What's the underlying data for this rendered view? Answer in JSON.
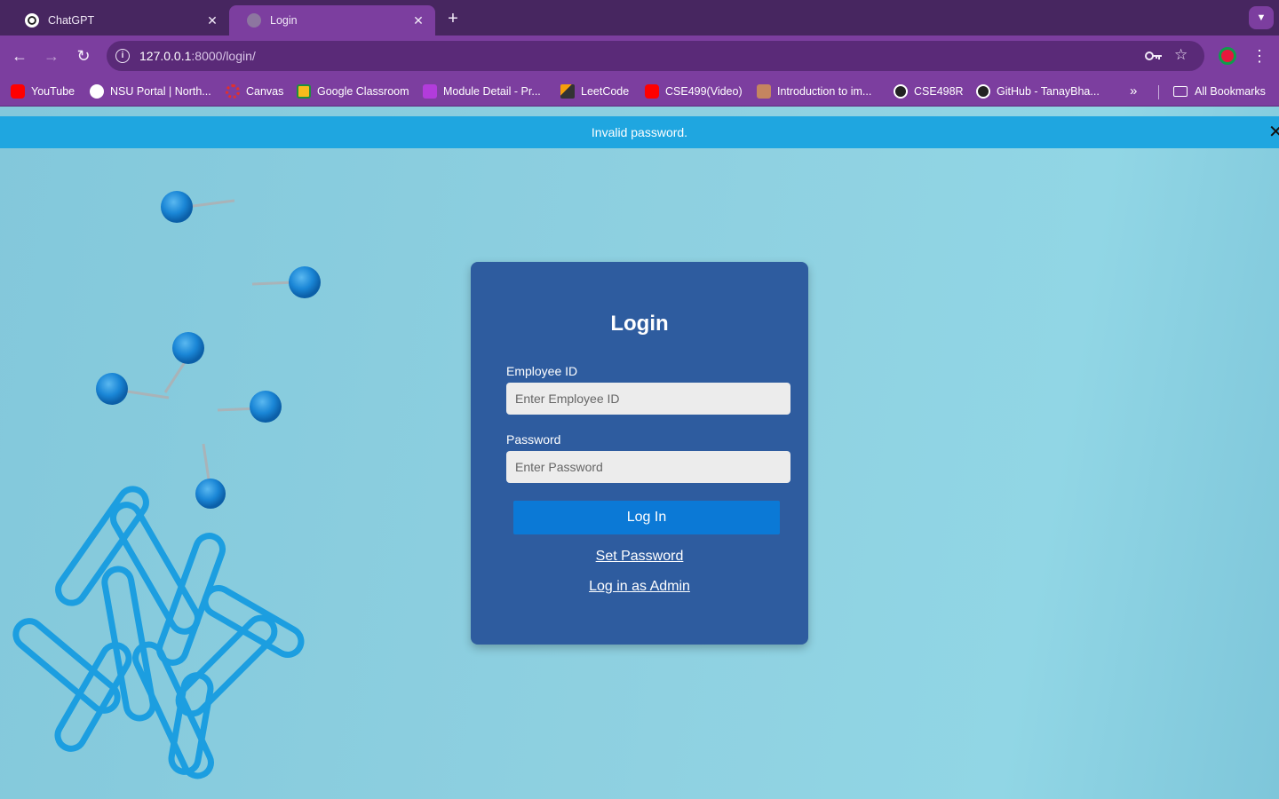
{
  "browser": {
    "tabs": [
      {
        "title": "ChatGPT",
        "icon": "chatgpt-icon",
        "active": false
      },
      {
        "title": "Login",
        "icon": "globe-icon",
        "active": true
      }
    ],
    "new_tab_label": "+",
    "url_host": "127.0.0.1",
    "url_rest": ":8000/login/",
    "bookmarks": [
      {
        "label": "YouTube",
        "icon": "youtube-icon",
        "color": "#ff0000"
      },
      {
        "label": "NSU Portal | North...",
        "icon": "globe-icon",
        "color": "#ffffff"
      },
      {
        "label": "Canvas",
        "icon": "canvas-icon",
        "color": "#e4302a"
      },
      {
        "label": "Google Classroom",
        "icon": "classroom-icon",
        "color": "#f6bb1c"
      },
      {
        "label": "Module Detail - Pr...",
        "icon": "module-icon",
        "color": "#b23cdb"
      },
      {
        "label": "LeetCode",
        "icon": "leetcode-icon",
        "color": "#f59e0b"
      },
      {
        "label": "CSE499(Video)",
        "icon": "youtube-icon",
        "color": "#ff0000"
      },
      {
        "label": "Introduction to im...",
        "icon": "avatar-icon",
        "color": "#c58560"
      },
      {
        "label": "CSE498R",
        "icon": "github-icon",
        "color": "#222222"
      },
      {
        "label": "GitHub - TanayBha...",
        "icon": "github-icon",
        "color": "#222222"
      }
    ],
    "more_bookmarks": "»",
    "all_bookmarks": "All Bookmarks"
  },
  "alert": {
    "message": "Invalid password.",
    "close": "✕"
  },
  "login": {
    "title": "Login",
    "employee_id_label": "Employee ID",
    "employee_id_placeholder": "Enter Employee ID",
    "password_label": "Password",
    "password_placeholder": "Enter Password",
    "submit_label": "Log In",
    "set_password_link": "Set Password",
    "admin_link": "Log in as Admin"
  },
  "colors": {
    "accent": "#0b79d6",
    "card": "#2e5c9f",
    "alert": "#1fa6e0",
    "browser_frame": "#7c3e9f"
  }
}
